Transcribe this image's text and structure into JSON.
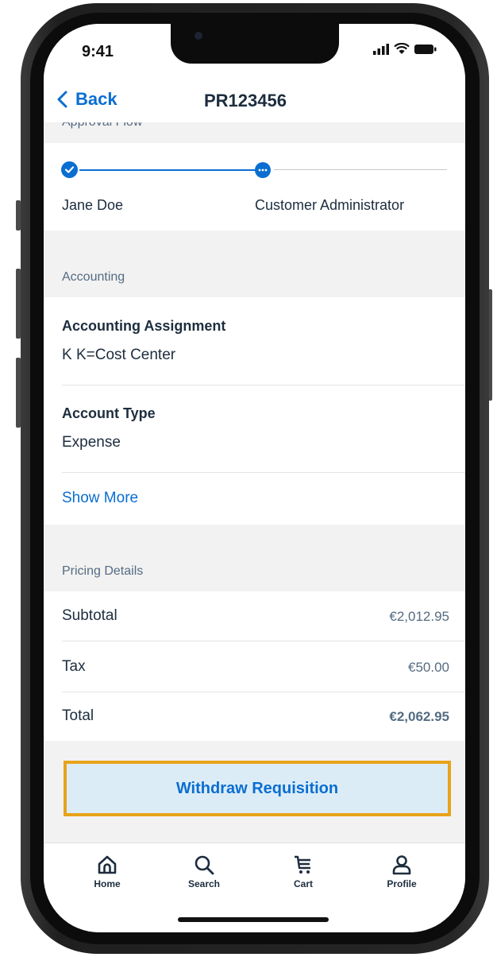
{
  "status_bar": {
    "time": "9:41"
  },
  "nav": {
    "back_label": "Back",
    "title": "PR123456"
  },
  "approval_flow": {
    "header": "Approval Flow",
    "steps": [
      {
        "name": "Jane Doe",
        "state": "completed"
      },
      {
        "name": "Customer Administrator",
        "state": "in-progress"
      }
    ]
  },
  "accounting": {
    "header": "Accounting",
    "fields": [
      {
        "label": "Accounting Assignment",
        "value": "K K=Cost Center"
      },
      {
        "label": "Account Type",
        "value": "Expense"
      }
    ],
    "show_more": "Show More"
  },
  "pricing": {
    "header": "Pricing Details",
    "rows": [
      {
        "label": "Subtotal",
        "value": "€2,012.95"
      },
      {
        "label": "Tax",
        "value": "€50.00"
      },
      {
        "label": "Total",
        "value": "€2,062.95"
      }
    ]
  },
  "actions": {
    "withdraw_label": "Withdraw Requisition"
  },
  "tabs": [
    {
      "label": "Home",
      "icon": "home-icon"
    },
    {
      "label": "Search",
      "icon": "search-icon"
    },
    {
      "label": "Cart",
      "icon": "cart-icon"
    },
    {
      "label": "Profile",
      "icon": "profile-icon"
    }
  ],
  "colors": {
    "accent": "#0a6ed1",
    "highlight": "#e8a31a",
    "text": "#1d2d3e",
    "muted": "#556b82"
  }
}
